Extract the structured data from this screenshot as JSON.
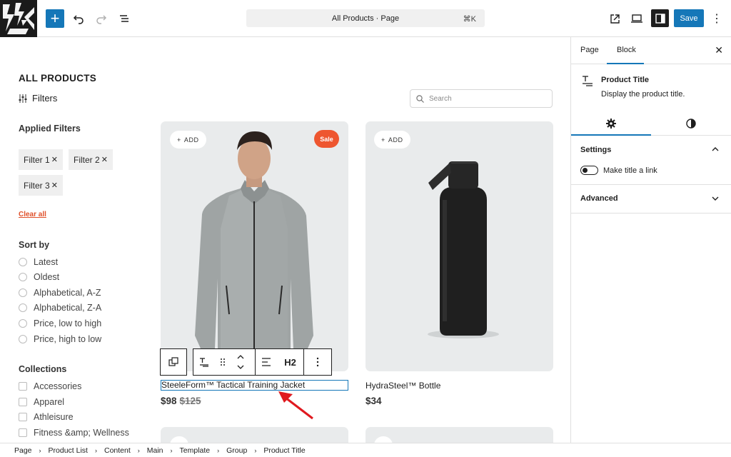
{
  "topbar": {
    "command_title": "All Products · Page",
    "command_shortcut": "⌘K",
    "save_label": "Save",
    "add_symbol": "+",
    "more_symbol": "⋮"
  },
  "canvas": {
    "heading": "ALL PRODUCTS",
    "filters_label": "Filters",
    "search_placeholder": "Search",
    "applied_filters": {
      "title": "Applied Filters",
      "chips": [
        "Filter 1",
        "Filter 2",
        "Filter 3"
      ],
      "chip_remove": "✕",
      "clear_all": "Clear all"
    },
    "sort_by": {
      "title": "Sort by",
      "options": [
        "Latest",
        "Oldest",
        "Alphabetical, A-Z",
        "Alphabetical, Z-A",
        "Price, low to high",
        "Price, high to low"
      ]
    },
    "collections": {
      "title": "Collections",
      "options": [
        "Accessories",
        "Apparel",
        "Athleisure",
        "Fitness &amp; Wellness"
      ]
    },
    "products": [
      {
        "add_label": "ADD",
        "badge": "Sale",
        "title": "SteeleForm™ Tactical Training Jacket",
        "price": "$98",
        "old_price": "$125"
      },
      {
        "add_label": "ADD",
        "title": "HydraSteel™ Bottle",
        "price": "$34"
      }
    ],
    "block_toolbar": {
      "heading_level": "H2"
    }
  },
  "sidebar": {
    "tabs": [
      "Page",
      "Block"
    ],
    "active_tab": "Block",
    "close_symbol": "✕",
    "block": {
      "title": "Product Title",
      "description": "Display the product title."
    },
    "settings": {
      "title": "Settings",
      "toggle_label": "Make title a link",
      "toggle_on": false
    },
    "advanced": {
      "title": "Advanced"
    }
  },
  "breadcrumb": [
    "Page",
    "Product List",
    "Content",
    "Main",
    "Template",
    "Group",
    "Product Title"
  ],
  "colors": {
    "accent": "#1577b8",
    "sale": "#ee5630",
    "card": "#e9ebec",
    "annotation_arrow": "#e0191f"
  }
}
